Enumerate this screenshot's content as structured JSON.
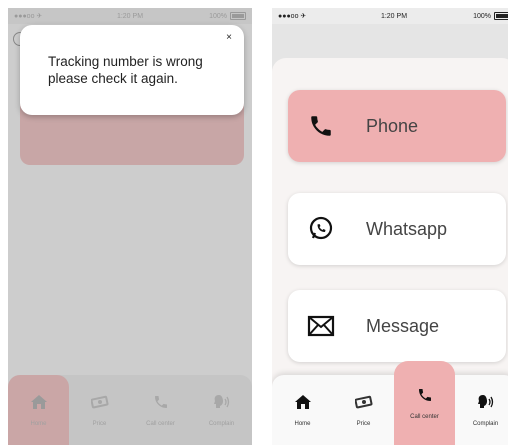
{
  "status_bar": {
    "carrier": "●●●oo ✈",
    "time": "1:20 PM",
    "battery": "100%"
  },
  "popup": {
    "message": "Tracking number is wrong please check it again.",
    "close_label": "×"
  },
  "contact_options": [
    {
      "label": "Phone",
      "icon": "phone-icon"
    },
    {
      "label": "Whatsapp",
      "icon": "whatsapp-icon"
    },
    {
      "label": "Message",
      "icon": "envelope-icon"
    }
  ],
  "tabs": [
    {
      "label": "Home",
      "icon": "home-icon"
    },
    {
      "label": "Price",
      "icon": "money-icon"
    },
    {
      "label": "Call center",
      "icon": "phone-icon"
    },
    {
      "label": "Complain",
      "icon": "speaking-head-icon"
    }
  ],
  "active_tab": {
    "left_screen": "Home",
    "right_screen": "Call center"
  },
  "colors": {
    "accent_pink": "#efb0b1",
    "dim_overlay": "#cdcdcd",
    "sheet_bg": "#f7f4f3"
  }
}
